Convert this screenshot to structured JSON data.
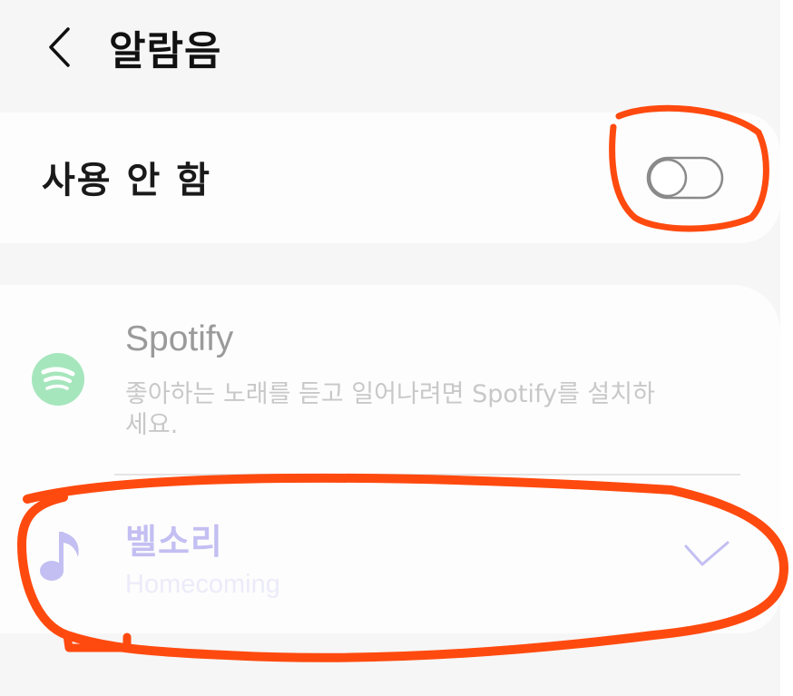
{
  "header": {
    "back_icon": "chevron-left-icon",
    "title": "알람음"
  },
  "off_option": {
    "label": "사용 안 함",
    "toggle_on": false
  },
  "spotify": {
    "icon": "spotify-icon",
    "title": "Spotify",
    "description": "좋아하는 노래를 듣고 일어나려면 Spotify를 설치하세요."
  },
  "ringtone": {
    "icon": "music-note-icon",
    "title": "벨소리",
    "subtitle": "Homecoming",
    "selected": true,
    "check_icon": "check-icon"
  },
  "colors": {
    "background": "#f6f6f6",
    "card": "#fdfdfd",
    "annotation": "#ff4a0f",
    "accent": "#c3bff2",
    "spotify_green": "#a6e6bd"
  }
}
